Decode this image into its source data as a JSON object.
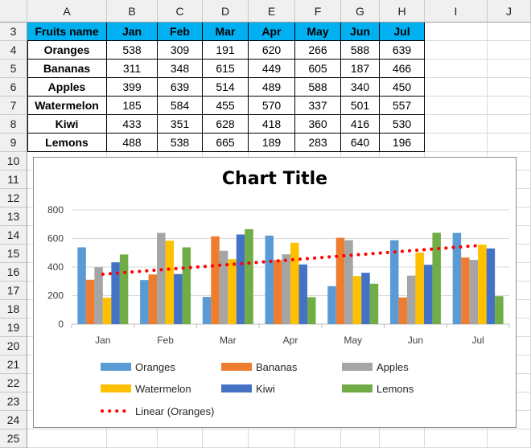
{
  "columns": [
    "A",
    "B",
    "C",
    "D",
    "E",
    "F",
    "G",
    "H",
    "I",
    "J"
  ],
  "rows": [
    "3",
    "4",
    "5",
    "6",
    "7",
    "8",
    "9",
    "10",
    "11",
    "12",
    "13",
    "14",
    "15",
    "16",
    "17",
    "18",
    "19",
    "20",
    "21",
    "22",
    "23",
    "24",
    "25"
  ],
  "table": {
    "headers": [
      "Fruits name",
      "Jan",
      "Feb",
      "Mar",
      "Apr",
      "May",
      "Jun",
      "Jul"
    ],
    "rows": [
      {
        "name": "Oranges",
        "values": [
          538,
          309,
          191,
          620,
          266,
          588,
          639
        ]
      },
      {
        "name": "Bananas",
        "values": [
          311,
          348,
          615,
          449,
          605,
          187,
          466
        ]
      },
      {
        "name": "Apples",
        "values": [
          399,
          639,
          514,
          489,
          588,
          340,
          450
        ]
      },
      {
        "name": "Watermelon",
        "values": [
          185,
          584,
          455,
          570,
          337,
          501,
          557
        ]
      },
      {
        "name": "Kiwi",
        "values": [
          433,
          351,
          628,
          418,
          360,
          416,
          530
        ]
      },
      {
        "name": "Lemons",
        "values": [
          488,
          538,
          665,
          189,
          283,
          640,
          196
        ]
      }
    ]
  },
  "chart_data": {
    "type": "bar",
    "title": "Chart Title",
    "categories": [
      "Jan",
      "Feb",
      "Mar",
      "Apr",
      "May",
      "Jun",
      "Jul"
    ],
    "series": [
      {
        "name": "Oranges",
        "color": "#5b9bd5",
        "values": [
          538,
          309,
          191,
          620,
          266,
          588,
          639
        ]
      },
      {
        "name": "Bananas",
        "color": "#ed7d31",
        "values": [
          311,
          348,
          615,
          449,
          605,
          187,
          466
        ]
      },
      {
        "name": "Apples",
        "color": "#a5a5a5",
        "values": [
          399,
          639,
          514,
          489,
          588,
          340,
          450
        ]
      },
      {
        "name": "Watermelon",
        "color": "#ffc000",
        "values": [
          185,
          584,
          455,
          570,
          337,
          501,
          557
        ]
      },
      {
        "name": "Kiwi",
        "color": "#4472c4",
        "values": [
          433,
          351,
          628,
          418,
          360,
          416,
          530
        ]
      },
      {
        "name": "Lemons",
        "color": "#70ad47",
        "values": [
          488,
          538,
          665,
          189,
          283,
          640,
          196
        ]
      }
    ],
    "trendline": {
      "name": "Linear (Oranges)",
      "color": "#ff0000",
      "style": "dotted",
      "of_series": "Oranges"
    },
    "ylim": [
      0,
      800
    ],
    "yticks": [
      0,
      200,
      400,
      600,
      800
    ],
    "grid": true,
    "legend_position": "bottom"
  }
}
